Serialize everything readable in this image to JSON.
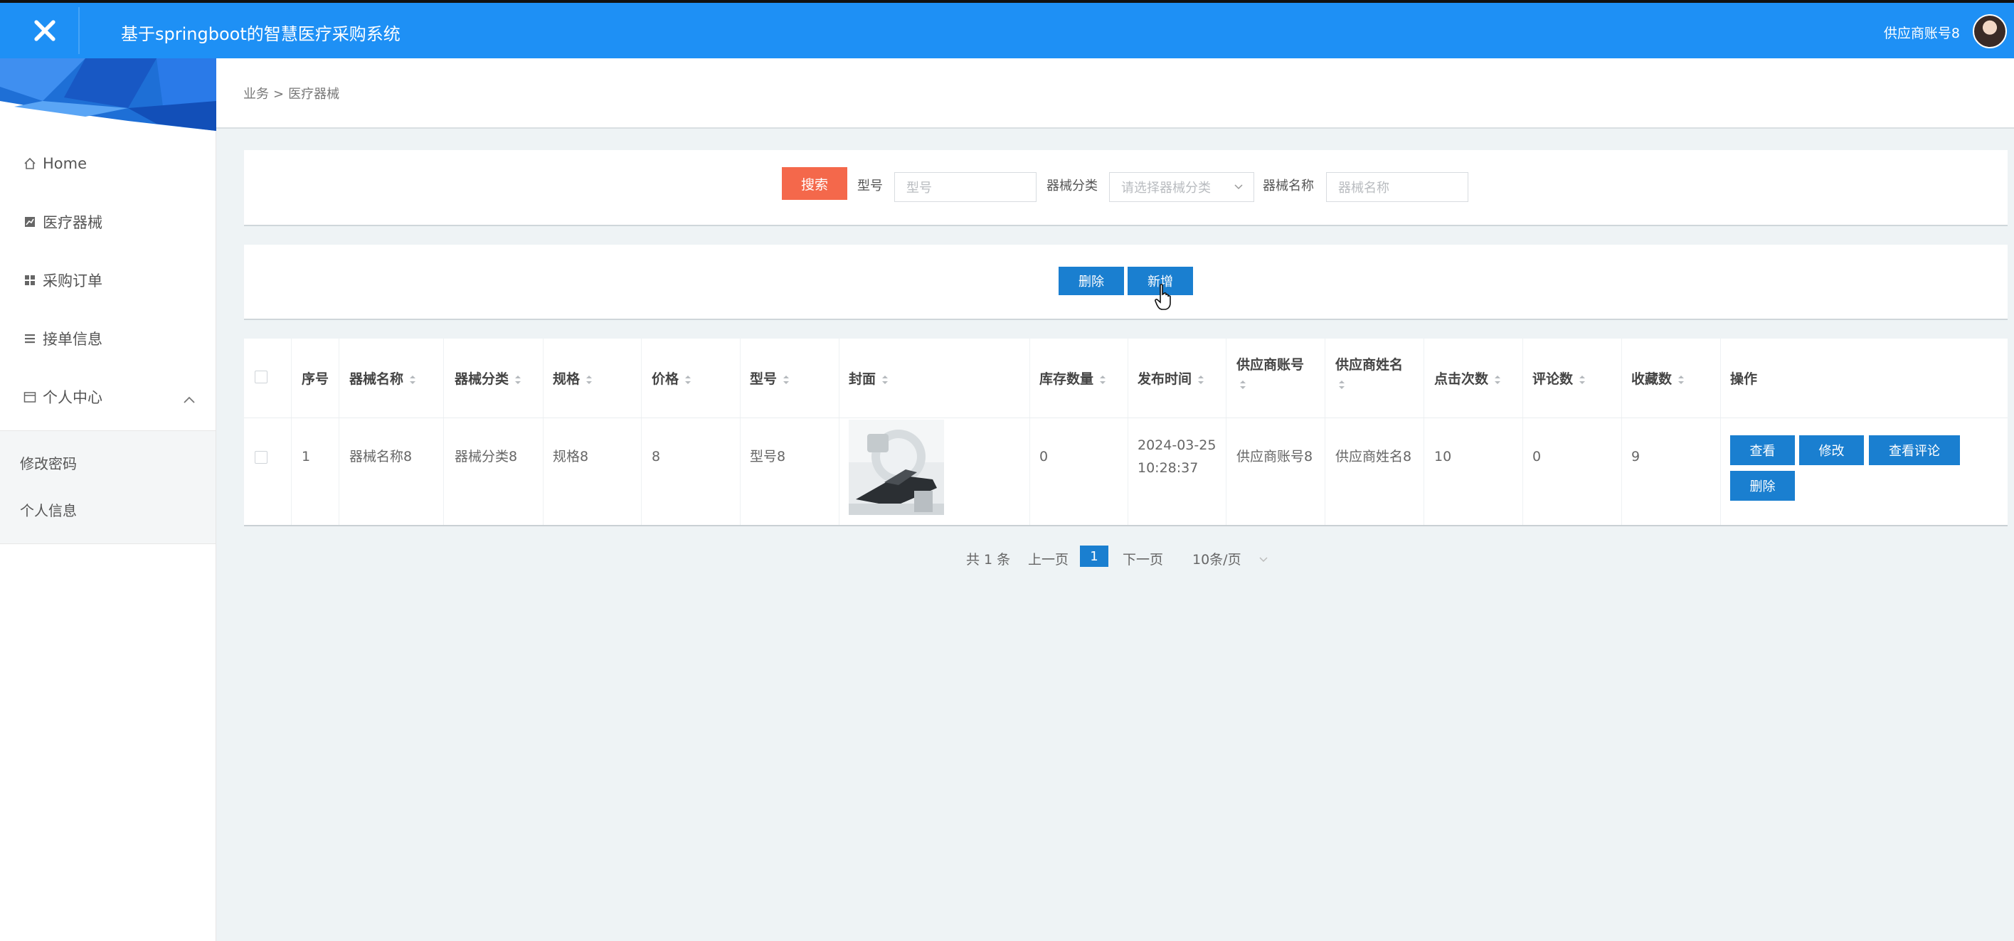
{
  "header": {
    "title": "基于springboot的智慧医疗采购系统",
    "user": "供应商账号8"
  },
  "sidebar": {
    "items": [
      {
        "label": "Home",
        "icon": "home-icon"
      },
      {
        "label": "医疗器械",
        "icon": "chart-icon"
      },
      {
        "label": "采购订单",
        "icon": "grid-icon"
      },
      {
        "label": "接单信息",
        "icon": "list-icon"
      },
      {
        "label": "个人中心",
        "icon": "calendar-icon"
      }
    ],
    "submenu": [
      "修改密码",
      "个人信息"
    ]
  },
  "breadcrumb": {
    "parent": "业务",
    "sep": ">",
    "current": "医疗器械"
  },
  "search": {
    "button": "搜索",
    "model_label": "型号",
    "model_placeholder": "型号",
    "category_label": "器械分类",
    "category_placeholder": "请选择器械分类",
    "name_label": "器械名称",
    "name_placeholder": "器械名称"
  },
  "actions": {
    "delete": "删除",
    "add": "新增"
  },
  "table": {
    "headers": {
      "index": "序号",
      "name": "器械名称",
      "category": "器械分类",
      "spec": "规格",
      "price": "价格",
      "model": "型号",
      "cover": "封面",
      "stock": "库存数量",
      "publish_time": "发布时间",
      "supplier_account": "供应商账号",
      "supplier_name": "供应商姓名",
      "clicks": "点击次数",
      "comments": "评论数",
      "favorites": "收藏数",
      "ops": "操作"
    },
    "rows": [
      {
        "index": "1",
        "name": "器械名称8",
        "category": "器械分类8",
        "spec": "规格8",
        "price": "8",
        "model": "型号8",
        "stock": "0",
        "publish_date": "2024-03-25",
        "publish_clock": "10:28:37",
        "supplier_account": "供应商账号8",
        "supplier_name": "供应商姓名8",
        "clicks": "10",
        "comments": "0",
        "favorites": "9",
        "op_view": "查看",
        "op_edit": "修改",
        "op_comments": "查看评论",
        "op_delete": "删除"
      }
    ]
  },
  "pagination": {
    "total": "共 1 条",
    "prev": "上一页",
    "current": "1",
    "next": "下一页",
    "page_size": "10条/页"
  },
  "colors": {
    "header": "#1e90f5",
    "primary": "#1a7fd0",
    "search": "#f4684b"
  }
}
